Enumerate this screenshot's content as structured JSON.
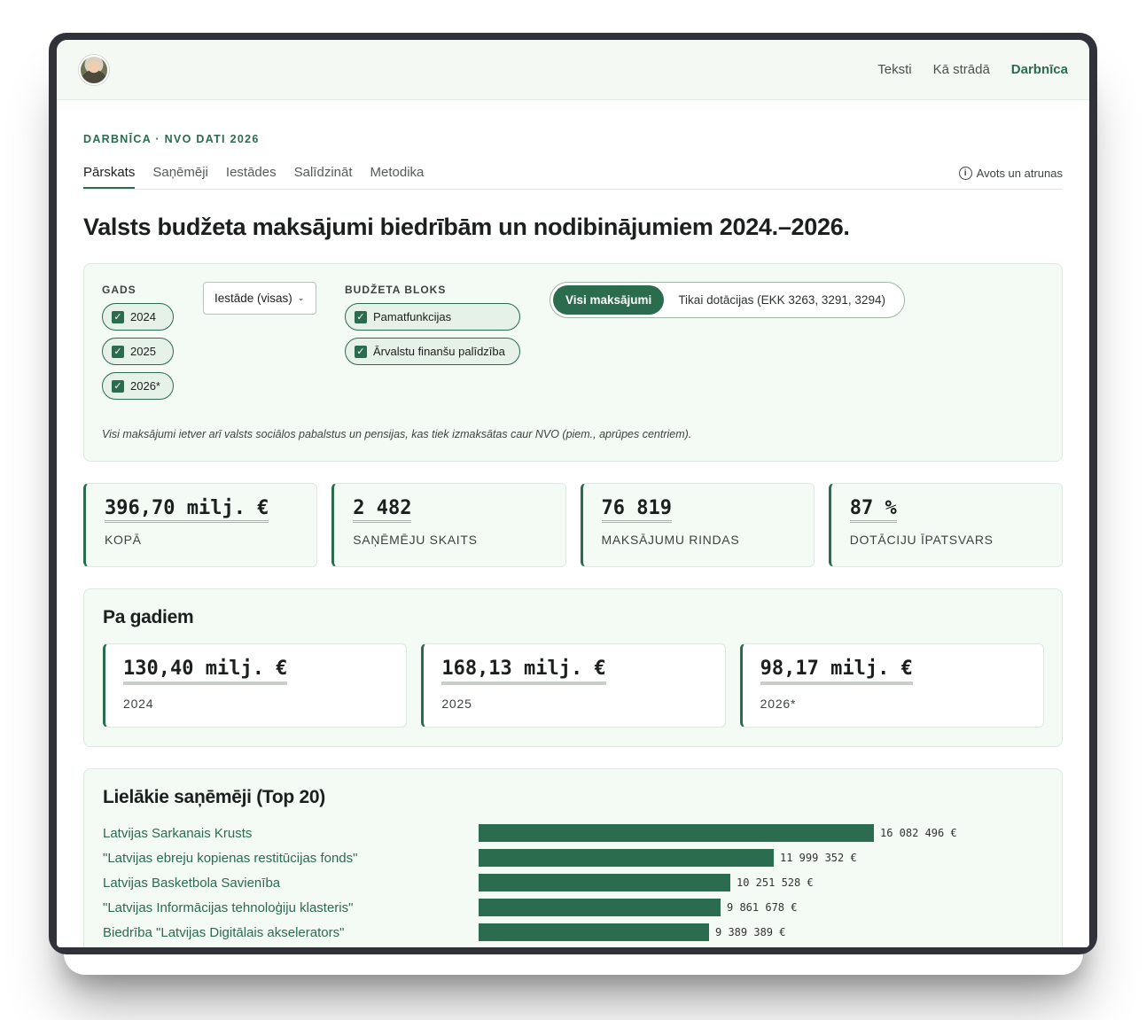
{
  "header": {
    "nav": [
      "Teksti",
      "Kā strādā",
      "Darbnīca"
    ],
    "active_nav": "Darbnīca"
  },
  "eyebrow": "DARBNĪCA · NVO DATI 2026",
  "tabs": [
    "Pārskats",
    "Saņēmēji",
    "Iestādes",
    "Salīdzināt",
    "Metodika"
  ],
  "active_tab": "Pārskats",
  "source_link": "Avots un atrunas",
  "title": "Valsts budžeta maksājumi biedrībām un nodibinājumiem 2024.–2026.",
  "filters": {
    "year_label": "GADS",
    "years": [
      "2024",
      "2025",
      "2026*"
    ],
    "institution_select": "Iestāde (visas)",
    "block_label": "BUDŽETA BLOKS",
    "blocks": [
      "Pamatfunkcijas",
      "Ārvalstu finanšu palīdzība"
    ],
    "toggle_on": "Visi maksājumi",
    "toggle_off": "Tikai dotācijas (EKK 3263, 3291, 3294)",
    "note": "Visi maksājumi ietver arī valsts sociālos pabalstus un pensijas, kas tiek izmaksātas caur NVO (piem., aprūpes centriem)."
  },
  "kpis": [
    {
      "value": "396,70 milj. €",
      "label": "KOPĀ"
    },
    {
      "value": "2 482",
      "label": "SAŅĒMĒJU SKAITS"
    },
    {
      "value": "76 819",
      "label": "MAKSĀJUMU RINDAS"
    },
    {
      "value": "87 %",
      "label": "DOTĀCIJU ĪPATSVARS"
    }
  ],
  "by_year": {
    "title": "Pa gadiem",
    "cards": [
      {
        "value": "130,40 milj. €",
        "label": "2024"
      },
      {
        "value": "168,13 milj. €",
        "label": "2025"
      },
      {
        "value": "98,17 milj. €",
        "label": "2026*"
      }
    ]
  },
  "top20": {
    "title": "Lielākie saņēmēji (Top 20)"
  },
  "colors": {
    "accent": "#2b6b4e",
    "panel_bg": "#f4faf4"
  },
  "chart_data": {
    "type": "bar",
    "orientation": "horizontal",
    "categories": [
      "Latvijas Sarkanais Krusts",
      "\"Latvijas ebreju kopienas restitūcijas fonds\"",
      "Latvijas Basketbola Savienība",
      "\"Latvijas Informācijas tehnoloģiju klasteris\"",
      "Biedrība \"Latvijas Digitālais akselerators\""
    ],
    "values": [
      16082496,
      11999352,
      10251528,
      9861678,
      9389389
    ],
    "value_labels": [
      "16 082 496 €",
      "11 999 352 €",
      "10 251 528 €",
      "9 861 678 €",
      "9 389 389 €"
    ]
  }
}
